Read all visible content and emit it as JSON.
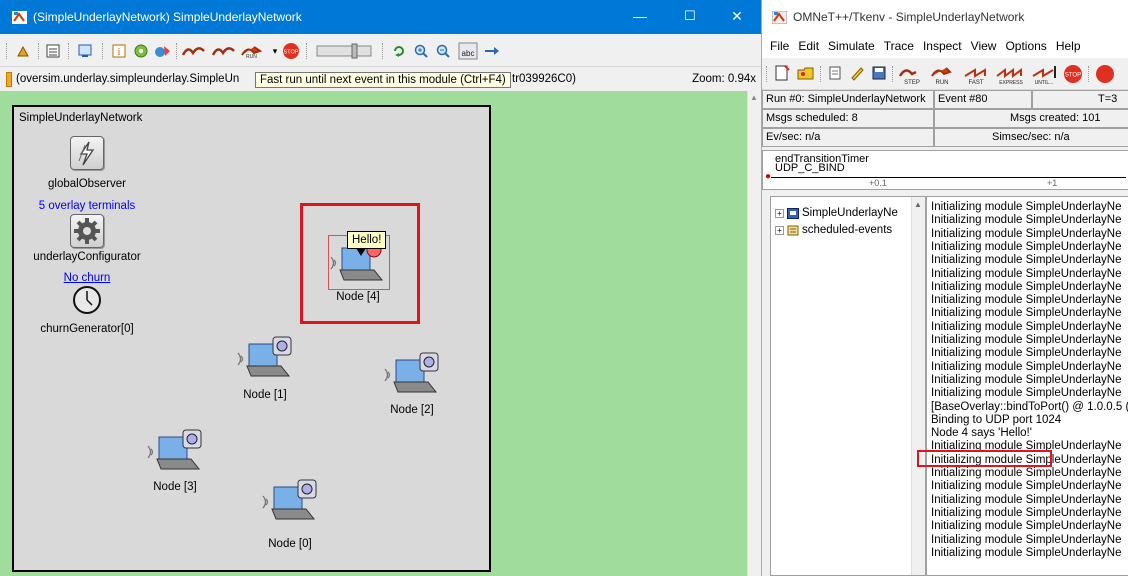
{
  "left_window": {
    "title": "(SimpleUnderlayNetwork) SimpleUnderlayNetwork",
    "path_text": "(oversim.underlay.simpleunderlay.SimpleUn",
    "path_tail": "tr039926C0)",
    "tooltip": "Fast run until next event in this module (Ctrl+F4)",
    "zoom": "Zoom: 0.94x",
    "network_title": "SimpleUnderlayNetwork",
    "modules": {
      "global_observer": "globalObserver",
      "overlay_terminals": "5 overlay terminals",
      "underlay_configurator": "underlayConfigurator",
      "no_churn": "No churn",
      "churn_generator": "churnGenerator[0]"
    },
    "nodes": [
      "Node [4]",
      "Node [1]",
      "Node [2]",
      "Node [3]",
      "Node [0]"
    ],
    "bubble": "Hello!",
    "toolbar_icons": [
      "redraw-icon",
      "layout-icon",
      "log-icon",
      "info-icon",
      "params-icon",
      "mode-icon",
      "step-icon",
      "run-icon",
      "fast-run-icon",
      "stop-icon",
      "slider-icon",
      "refresh-icon",
      "zoom-in-icon",
      "zoom-out-icon",
      "labels-icon",
      "arrow-icon"
    ]
  },
  "right_window": {
    "title": "OMNeT++/Tkenv - SimpleUnderlayNetwork",
    "menu": [
      "File",
      "Edit",
      "Simulate",
      "Trace",
      "Inspect",
      "View",
      "Options",
      "Help"
    ],
    "toolbar_labels": [
      "STEP",
      "RUN",
      "FAST",
      "EXPRESS",
      "UNTIL...",
      "STOP"
    ],
    "run_info": "Run #0: SimpleUnderlayNetwork",
    "event": "Event #80",
    "time": "T=3",
    "msgs_scheduled": "Msgs scheduled: 8",
    "msgs_created": "Msgs created: 101",
    "ev_sec": "Ev/sec: n/a",
    "simsec_sec": "Simsec/sec: n/a",
    "timeline_labels": [
      "endTransitionTimer",
      "UDP_C_BIND"
    ],
    "timeline_ticks": [
      "+0.1",
      "+1"
    ],
    "tree": [
      "SimpleUnderlayNe",
      "scheduled-events"
    ],
    "log_lines": [
      "Initializing module SimpleUnderlayNe",
      "Initializing module SimpleUnderlayNe",
      "Initializing module SimpleUnderlayNe",
      "Initializing module SimpleUnderlayNe",
      "Initializing module SimpleUnderlayNe",
      "Initializing module SimpleUnderlayNe",
      "Initializing module SimpleUnderlayNe",
      "Initializing module SimpleUnderlayNe",
      "Initializing module SimpleUnderlayNe",
      "Initializing module SimpleUnderlayNe",
      "Initializing module SimpleUnderlayNe",
      "Initializing module SimpleUnderlayNe",
      "Initializing module SimpleUnderlayNe",
      "Initializing module SimpleUnderlayNe",
      "Initializing module SimpleUnderlayNe",
      "[BaseOverlay::bindToPort() @ 1.0.0.5 (",
      "   Binding to UDP port 1024",
      "Node 4 says 'Hello!'",
      "Initializing module SimpleUnderlayNe",
      "Initializing module SimpleUnderlayNe",
      "Initializing module SimpleUnderlayNe",
      "Initializing module SimpleUnderlayNe",
      "Initializing module SimpleUnderlayNe",
      "Initializing module SimpleUnderlayNe",
      "Initializing module SimpleUnderlayNe",
      "Initializing module SimpleUnderlayNe",
      "Initializing module SimpleUnderlayNe"
    ]
  },
  "colors": {
    "titlebar": "#0078d7",
    "canvas": "#a0dc9c",
    "network_bg": "#d9d9d9",
    "highlight": "#e0141e",
    "bubble": "#ffffc8",
    "link": "#0000ff"
  }
}
